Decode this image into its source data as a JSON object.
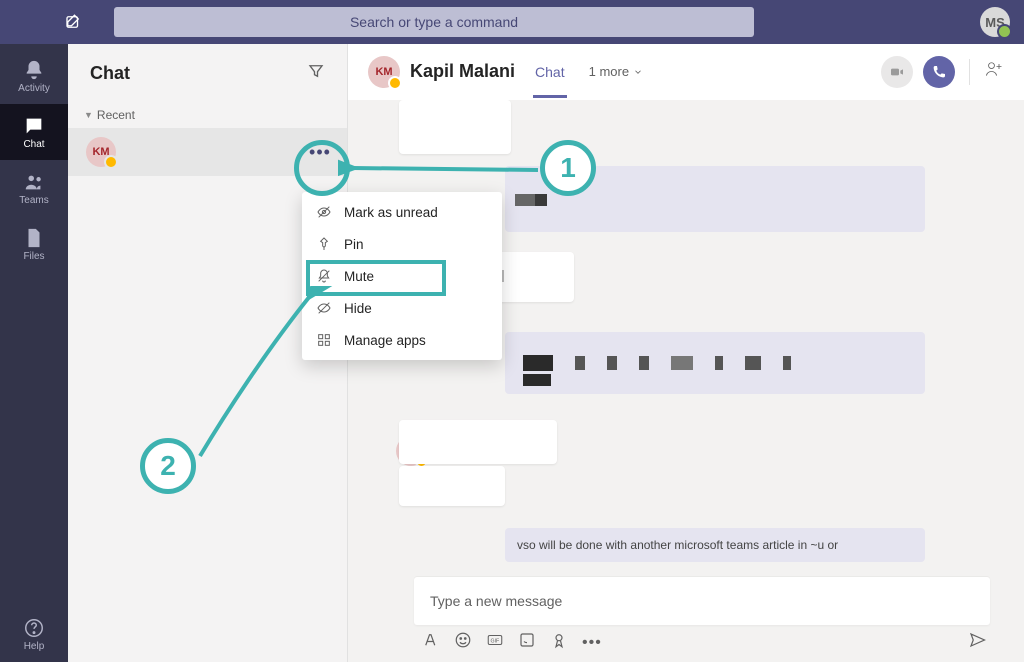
{
  "topbar": {
    "search_placeholder": "Search or type a command",
    "user_initials": "MS"
  },
  "rail": {
    "items": [
      {
        "id": "activity",
        "label": "Activity"
      },
      {
        "id": "chat",
        "label": "Chat"
      },
      {
        "id": "teams",
        "label": "Teams"
      },
      {
        "id": "files",
        "label": "Files"
      }
    ],
    "help_label": "Help"
  },
  "chat_list": {
    "title": "Chat",
    "section_label": "Recent",
    "items": [
      {
        "initials": "KM"
      }
    ]
  },
  "conversation": {
    "participant_initials": "KM",
    "participant_name": "Kapil Malani",
    "tab_label": "Chat",
    "more_label": "1 more",
    "sender_initials": "KM",
    "teaser": "vso will be done with another microsoft teams article in ~u or"
  },
  "composer": {
    "placeholder": "Type a new message"
  },
  "context_menu": {
    "items": [
      {
        "id": "mark-unread",
        "label": "Mark as unread"
      },
      {
        "id": "pin",
        "label": "Pin"
      },
      {
        "id": "mute",
        "label": "Mute"
      },
      {
        "id": "hide",
        "label": "Hide"
      },
      {
        "id": "manage-apps",
        "label": "Manage apps"
      }
    ]
  },
  "annotations": {
    "step_1": "1",
    "step_2": "2"
  }
}
